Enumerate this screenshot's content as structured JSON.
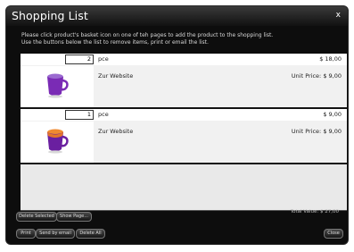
{
  "window": {
    "title": "Shopping List",
    "close_label": "x"
  },
  "instructions": [
    "Please click product's basket icon on one of teh pages to add the product to the shopping list.",
    "Use the buttons below the list to remove items, print or email the list."
  ],
  "items": [
    {
      "quantity": "2",
      "unit": "pce",
      "line_total": "$ 18,00",
      "link": "Zur Website",
      "unit_price": "Unit Price: $  9,00",
      "image": "purple-mug",
      "colors": {
        "body": "#7a2bb5",
        "inner": "#9b6ad0"
      }
    },
    {
      "quantity": "1",
      "unit": "pce",
      "line_total": "$   9,00",
      "link": "Zur Website",
      "unit_price": "Unit Price: $  9,00",
      "image": "orange-purple-mug",
      "colors": {
        "body": "#6a1fa0",
        "inner": "#f08a30"
      }
    }
  ],
  "total_value": "Total Value: $ 27,00",
  "buttons": {
    "delete_selected": "Delete Selected",
    "show_page": "Show Page...",
    "print": "Print",
    "send_by_email": "Send by email",
    "delete_all": "Delete All",
    "close": "Close"
  }
}
